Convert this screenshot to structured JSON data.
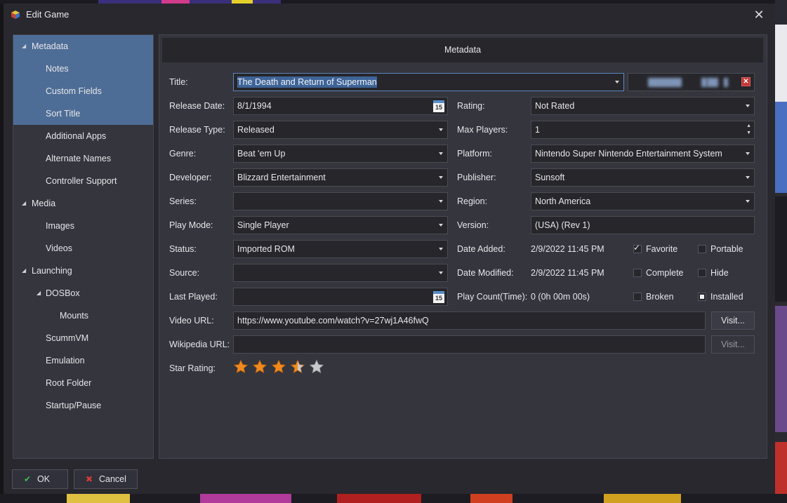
{
  "window": {
    "title": "Edit Game"
  },
  "tree": [
    {
      "label": "Metadata",
      "arrow": "◢",
      "level": 0,
      "selected": true
    },
    {
      "label": "Notes",
      "level": 1,
      "selected": true
    },
    {
      "label": "Custom Fields",
      "level": 1,
      "selected": true
    },
    {
      "label": "Sort Title",
      "level": 1,
      "selected": true
    },
    {
      "label": "Additional Apps",
      "level": 1
    },
    {
      "label": "Alternate Names",
      "level": 1
    },
    {
      "label": "Controller Support",
      "level": 1
    },
    {
      "label": "Media",
      "arrow": "◢",
      "level": 0
    },
    {
      "label": "Images",
      "level": 1
    },
    {
      "label": "Videos",
      "level": 1
    },
    {
      "label": "Launching",
      "arrow": "◢",
      "level": 0
    },
    {
      "label": "DOSBox",
      "arrow": "◢",
      "level": 1
    },
    {
      "label": "Mounts",
      "level": 2
    },
    {
      "label": "ScummVM",
      "level": 1
    },
    {
      "label": "Emulation",
      "level": 1
    },
    {
      "label": "Root Folder",
      "level": 1
    },
    {
      "label": "Startup/Pause",
      "level": 1
    }
  ],
  "panel": {
    "header": "Metadata"
  },
  "form": {
    "title_label": "Title:",
    "title_value": "The Death and Return of Superman",
    "release_date_label": "Release Date:",
    "release_date_value": "8/1/1994",
    "release_type_label": "Release Type:",
    "release_type_value": "Released",
    "genre_label": "Genre:",
    "genre_value": "Beat 'em Up",
    "developer_label": "Developer:",
    "developer_value": "Blizzard Entertainment",
    "series_label": "Series:",
    "series_value": "",
    "play_mode_label": "Play Mode:",
    "play_mode_value": "Single Player",
    "status_label": "Status:",
    "status_value": "Imported ROM",
    "source_label": "Source:",
    "source_value": "",
    "last_played_label": "Last Played:",
    "last_played_value": "",
    "video_url_label": "Video URL:",
    "video_url_value": "https://www.youtube.com/watch?v=27wj1A46fwQ",
    "wikipedia_url_label": "Wikipedia URL:",
    "wikipedia_url_value": "",
    "star_rating_label": "Star Rating:",
    "star_rating": 3.5,
    "star_max": 5,
    "rating_label": "Rating:",
    "rating_value": "Not Rated",
    "max_players_label": "Max Players:",
    "max_players_value": "1",
    "platform_label": "Platform:",
    "platform_value": "Nintendo Super Nintendo Entertainment System",
    "publisher_label": "Publisher:",
    "publisher_value": "Sunsoft",
    "region_label": "Region:",
    "region_value": "North America",
    "version_label": "Version:",
    "version_value": "(USA) (Rev 1)",
    "date_added_label": "Date Added:",
    "date_added_value": "2/9/2022 11:45 PM",
    "date_modified_label": "Date Modified:",
    "date_modified_value": "2/9/2022 11:45 PM",
    "play_count_label": "Play Count(Time):",
    "play_count_value": "0 (0h 00m 00s)",
    "calendar_day": "15",
    "visit_label": "Visit..."
  },
  "checkboxes": {
    "favorite": {
      "label": "Favorite",
      "checked": true
    },
    "portable": {
      "label": "Portable",
      "checked": false
    },
    "complete": {
      "label": "Complete",
      "checked": false
    },
    "hide": {
      "label": "Hide",
      "checked": false
    },
    "broken": {
      "label": "Broken",
      "checked": false
    },
    "installed": {
      "label": "Installed",
      "checked": "indeterminate"
    }
  },
  "buttons": {
    "ok": "OK",
    "cancel": "Cancel"
  },
  "colors": {
    "selection": "#4e6d96",
    "star": "#f08a1e",
    "star_empty": "#c8c8cc"
  }
}
